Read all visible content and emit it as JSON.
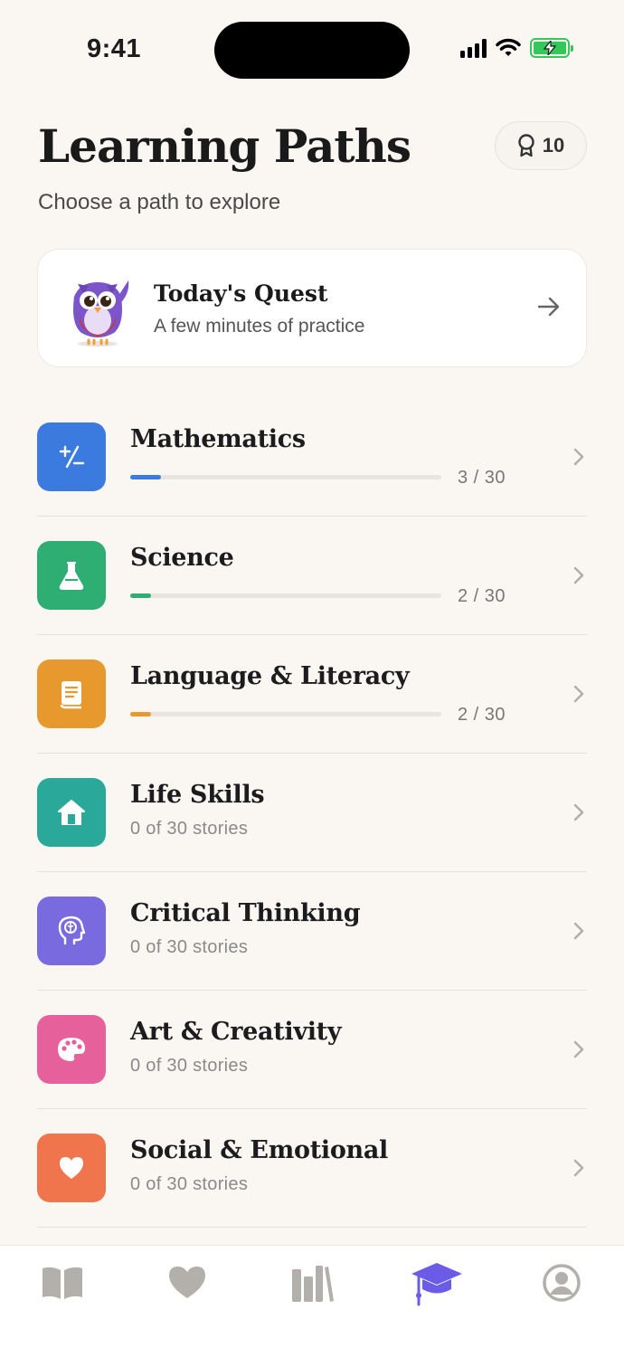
{
  "status_bar": {
    "time": "9:41"
  },
  "header": {
    "title": "Learning Paths",
    "subtitle": "Choose a path to explore",
    "badge_count": "10"
  },
  "quest": {
    "title": "Today's Quest",
    "subtitle": "A few minutes of practice"
  },
  "paths": [
    {
      "title": "Mathematics",
      "type": "progress",
      "progress": 0.1,
      "count": "3 / 30",
      "color": "#3b7bdf",
      "icon": "plus-minus-icon"
    },
    {
      "title": "Science",
      "type": "progress",
      "progress": 0.067,
      "count": "2 / 30",
      "color": "#2fae74",
      "icon": "flask-icon"
    },
    {
      "title": "Language & Literacy",
      "type": "progress",
      "progress": 0.067,
      "count": "2 / 30",
      "color": "#e8992e",
      "icon": "book-icon"
    },
    {
      "title": "Life Skills",
      "type": "stories",
      "stories": "0 of 30 stories",
      "color": "#2aa99a",
      "icon": "house-icon"
    },
    {
      "title": "Critical Thinking",
      "type": "stories",
      "stories": "0 of 30 stories",
      "color": "#7a6ae0",
      "icon": "brain-icon"
    },
    {
      "title": "Art & Creativity",
      "type": "stories",
      "stories": "0 of 30 stories",
      "color": "#e6619b",
      "icon": "palette-icon"
    },
    {
      "title": "Social & Emotional",
      "type": "stories",
      "stories": "0 of 30 stories",
      "color": "#f0744c",
      "icon": "heart-icon"
    }
  ],
  "tab_bar": {
    "tabs": [
      "book-open-icon",
      "heart-icon",
      "library-icon",
      "graduation-cap-icon",
      "profile-icon"
    ],
    "active_index": 3,
    "active_color": "#6b5ce7",
    "inactive_color": "#b3b0ab"
  }
}
